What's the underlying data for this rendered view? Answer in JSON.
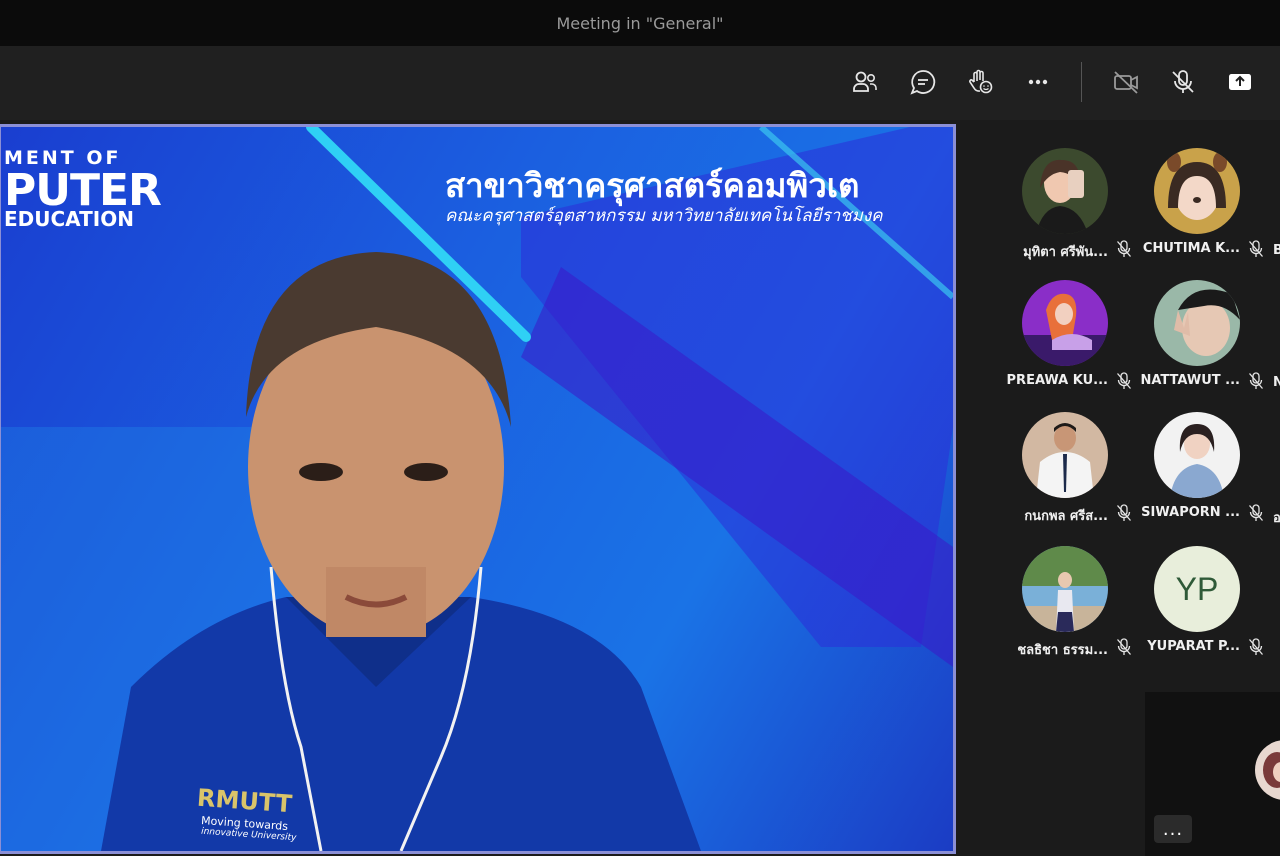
{
  "window": {
    "title": "Meeting in \"General\""
  },
  "toolbar": {
    "buttons": [
      {
        "name": "people-button",
        "icon": "people-icon"
      },
      {
        "name": "chat-button",
        "icon": "chat-icon"
      },
      {
        "name": "raise-hand-button",
        "icon": "raise-hand-icon"
      },
      {
        "name": "more-actions-button",
        "icon": "more-icon"
      },
      {
        "name": "camera-button",
        "icon": "camera-off-icon"
      },
      {
        "name": "mic-button",
        "icon": "mic-off-icon"
      },
      {
        "name": "share-button",
        "icon": "share-tray-icon"
      }
    ]
  },
  "speaker": {
    "backdrop": {
      "dept_line1": "MENT OF",
      "dept_line2": "PUTER",
      "dept_line3": "EDUCATION",
      "title": "สาขาวิชาครุศาสตร์คอมพิวเต",
      "subtitle": "คณะครุศาสตร์อุตสาหกรรม มหาวิทยาลัยเทคโนโลยีราชมงค",
      "shirt_logo": "RMUTT",
      "shirt_tagline1": "Moving towards",
      "shirt_tagline2": "innovative University"
    },
    "border_color": "#8b8fd6"
  },
  "participants": [
    {
      "name": "มุทิตา ศรีพัน...",
      "muted": true
    },
    {
      "name": "CHUTIMA K...",
      "muted": true
    },
    {
      "name": "PREAWA KU...",
      "muted": true
    },
    {
      "name": "NATTAWUT ...",
      "muted": true
    },
    {
      "name": "กนกพล ศรีส...",
      "muted": true
    },
    {
      "name": "SIWAPORN ...",
      "muted": true
    },
    {
      "name": "ชลธิชา ธรรม...",
      "muted": true
    },
    {
      "name": "YUPARAT P...",
      "muted": true,
      "initials": "YP"
    }
  ],
  "participants_partial": [
    "B",
    "N",
    "อ"
  ],
  "self_view": {
    "more_label": "..."
  },
  "colors": {
    "titlebar": "#0b0b0b",
    "toolbar": "#202020",
    "panel": "#1b1b1b",
    "accent": "#8b8fd6"
  }
}
